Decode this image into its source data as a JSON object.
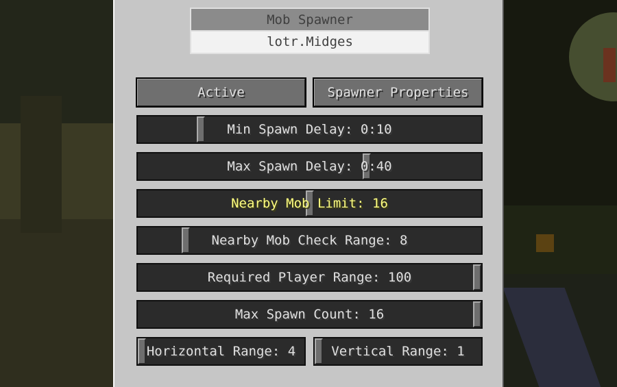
{
  "panel": {
    "title": "Mob Spawner",
    "subtitle": "lotr.Midges"
  },
  "tabs": {
    "active_label": "Active",
    "properties_label": "Spawner Properties"
  },
  "sliders": [
    {
      "name": "min-spawn-delay-slider",
      "label": "Min Spawn Delay: 0:10",
      "level": 0.175,
      "highlight": false
    },
    {
      "name": "max-spawn-delay-slider",
      "label": "Max Spawn Delay: 0:40",
      "level": 0.67,
      "highlight": false
    },
    {
      "name": "nearby-mob-limit-slider",
      "label": "Nearby Mob Limit: 16",
      "level": 0.5,
      "highlight": true
    },
    {
      "name": "nearby-mob-check-range-slider",
      "label": "Nearby Mob Check Range: 8",
      "level": 0.13,
      "highlight": false
    },
    {
      "name": "required-player-range-slider",
      "label": "Required Player Range: 100",
      "level": 1.0,
      "highlight": false
    },
    {
      "name": "max-spawn-count-slider",
      "label": "Max Spawn Count: 16",
      "level": 1.0,
      "highlight": false
    }
  ],
  "half_sliders": [
    {
      "name": "horizontal-range-slider",
      "label": "Horizontal Range: 4",
      "level": 0.0
    },
    {
      "name": "vertical-range-slider",
      "label": "Vertical Range: 1",
      "level": 0.0
    }
  ]
}
